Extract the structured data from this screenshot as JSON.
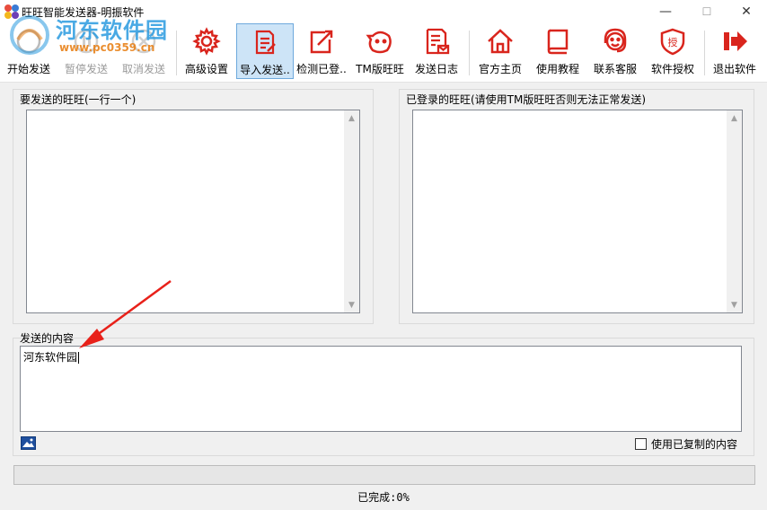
{
  "window": {
    "title": "旺旺智能发送器-明振软件",
    "controls": {
      "minimize": "—",
      "maximize": "☐",
      "close": "✕"
    }
  },
  "watermark": {
    "site": "河东软件园",
    "url": "www.pc0359.cn"
  },
  "toolbar": {
    "items": [
      {
        "label": "开始发送",
        "icon": "send-icon",
        "state": "normal"
      },
      {
        "label": "暂停发送",
        "icon": "pause-icon",
        "state": "disabled"
      },
      {
        "label": "取消发送",
        "icon": "cancel-icon",
        "state": "disabled"
      },
      {
        "label": "高级设置",
        "icon": "gear-icon",
        "state": "normal"
      },
      {
        "label": "导入发送..",
        "icon": "import-icon",
        "state": "active"
      },
      {
        "label": "检测已登..",
        "icon": "check-login-icon",
        "state": "normal"
      },
      {
        "label": "TM版旺旺",
        "icon": "wangwang-icon",
        "state": "normal"
      },
      {
        "label": "发送日志",
        "icon": "log-icon",
        "state": "normal"
      },
      {
        "label": "官方主页",
        "icon": "home-icon",
        "state": "normal"
      },
      {
        "label": "使用教程",
        "icon": "book-icon",
        "state": "normal"
      },
      {
        "label": "联系客服",
        "icon": "support-icon",
        "state": "normal"
      },
      {
        "label": "软件授权",
        "icon": "license-icon",
        "state": "normal"
      },
      {
        "label": "退出软件",
        "icon": "exit-icon",
        "state": "normal"
      }
    ],
    "accent_color": "#d9251d"
  },
  "send_list": {
    "label": "要发送的旺旺(一行一个)",
    "value": ""
  },
  "logged_list": {
    "label": "已登录的旺旺(请使用TM版旺旺否则无法正常发送)",
    "value": ""
  },
  "content": {
    "label": "发送的内容",
    "value": "河东软件园"
  },
  "use_copied": {
    "label": "使用已复制的内容",
    "checked": false
  },
  "progress": {
    "percent": 0
  },
  "status": {
    "prefix": "已完成:",
    "value": "0%"
  }
}
